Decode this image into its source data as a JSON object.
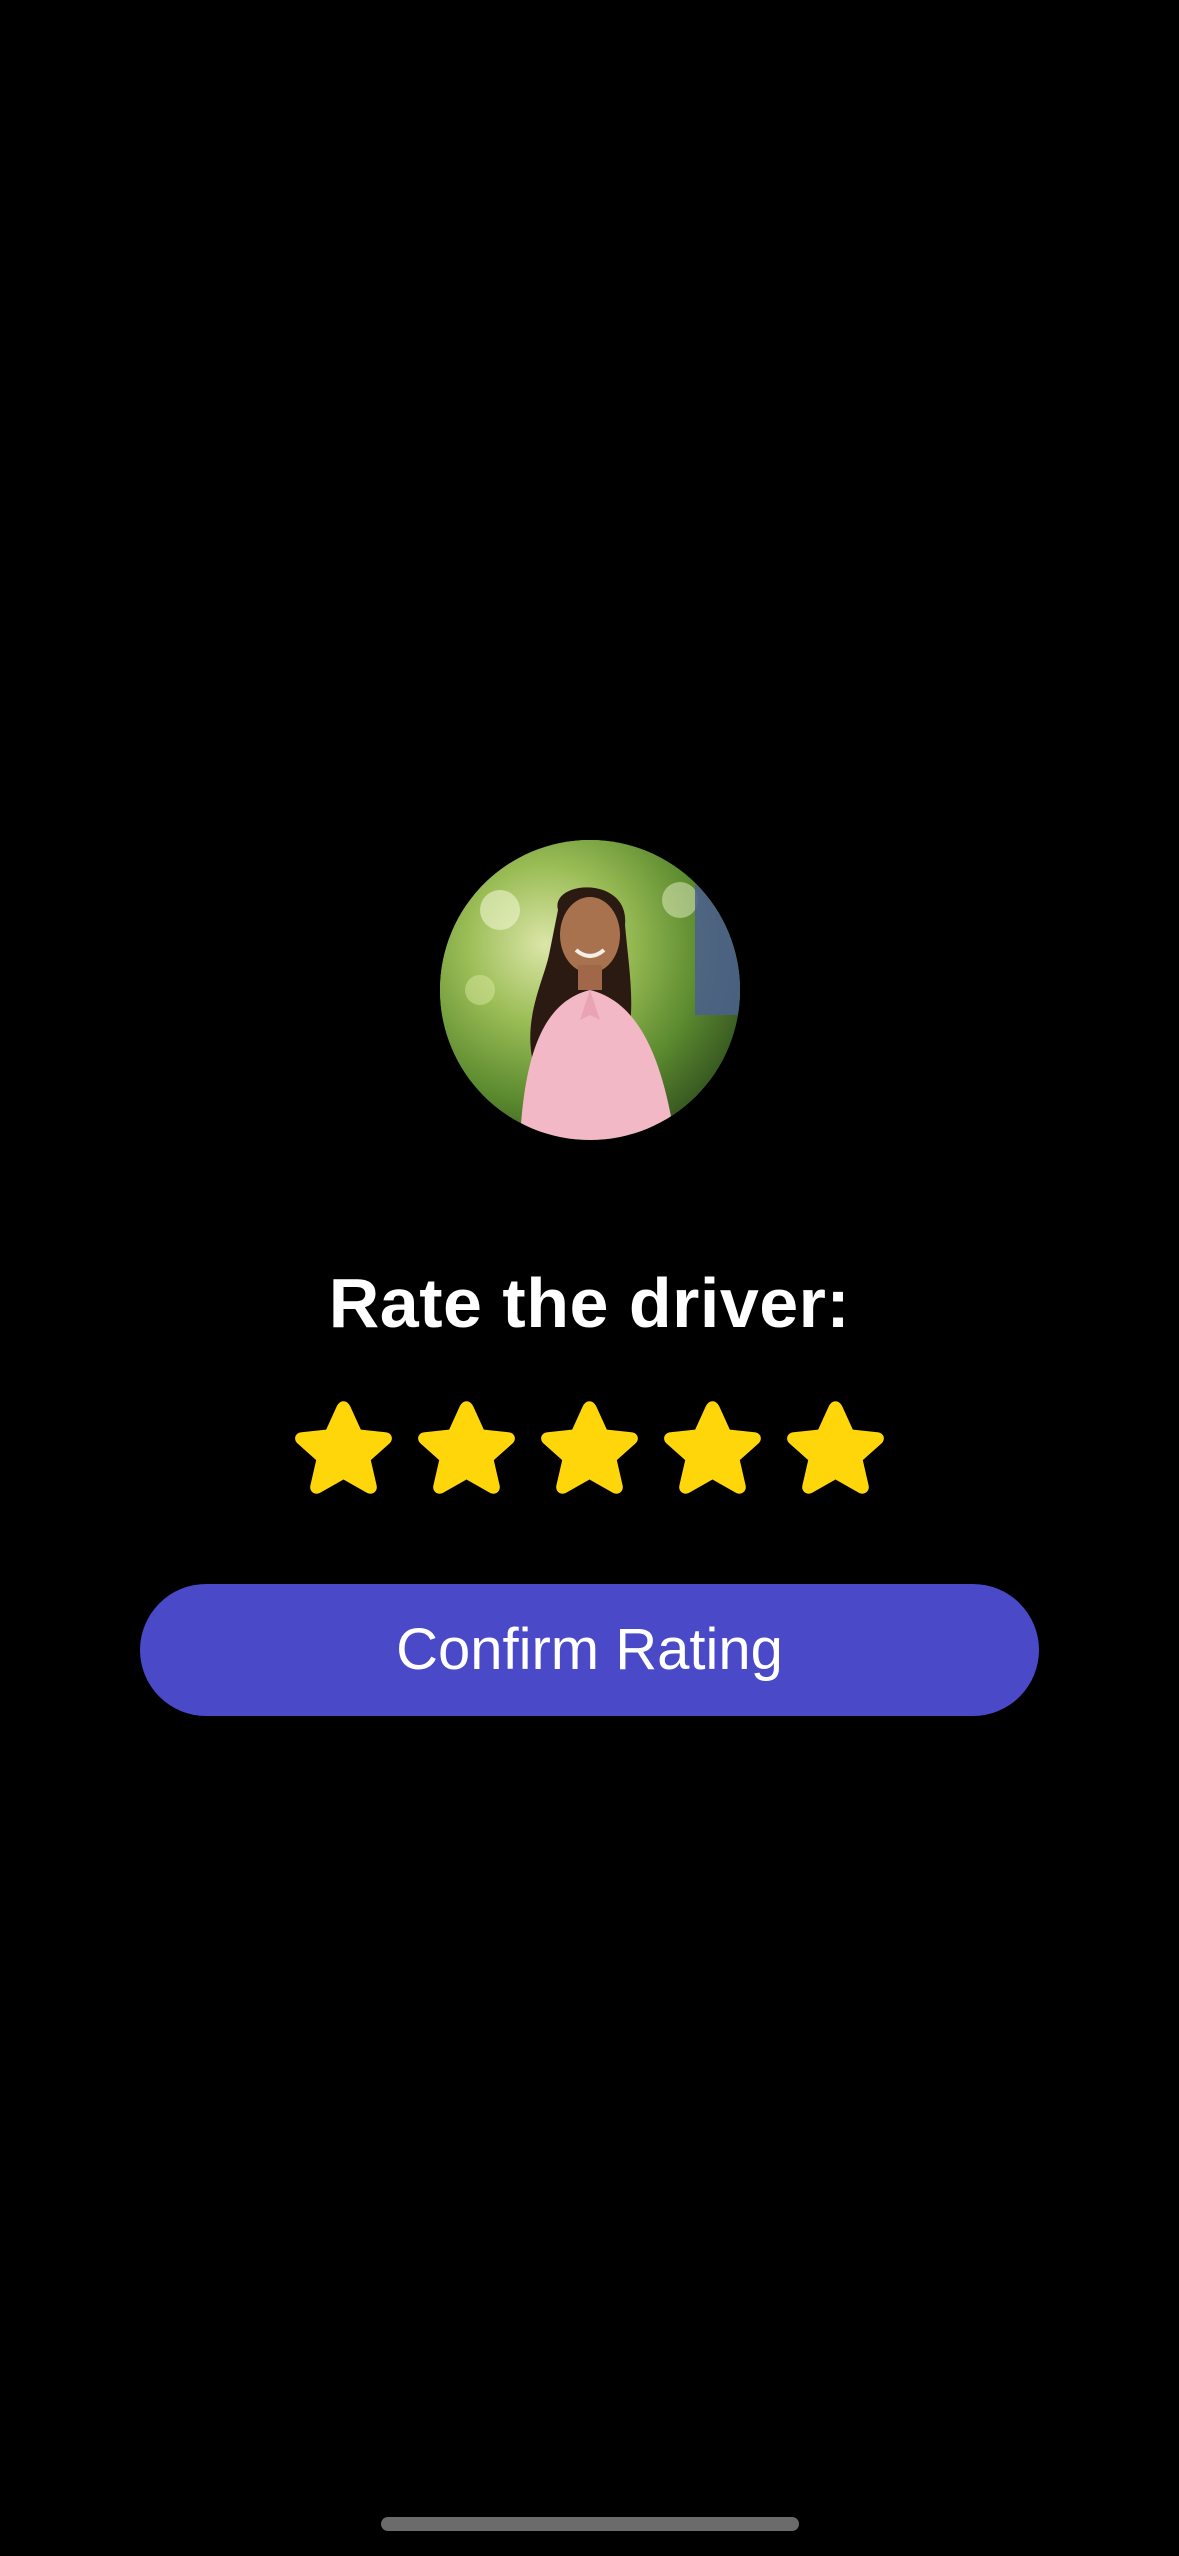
{
  "screen": {
    "background_color": "#000000"
  },
  "avatar": {
    "icon": "driver-photo"
  },
  "rating": {
    "title": "Rate the driver:",
    "value": 5,
    "max": 5,
    "star_color": "#FFD60A",
    "star_icon": "star-icon"
  },
  "confirm_button": {
    "label": "Confirm Rating",
    "background_color": "#4A49C7"
  }
}
